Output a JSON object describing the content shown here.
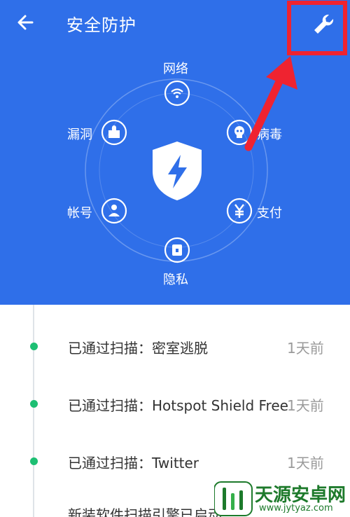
{
  "header": {
    "title": "安全防护",
    "back_icon": "arrow-left-icon",
    "settings_icon": "wrench-icon",
    "background_color": "#2f6fe9"
  },
  "annotation": {
    "box_color": "#ef2330",
    "arrow_color": "#ef2330"
  },
  "protection": {
    "center_icon": "lightning-shield-icon",
    "items": [
      {
        "label": "网络",
        "icon": "wifi-icon"
      },
      {
        "label": "病毒",
        "icon": "skull-icon"
      },
      {
        "label": "支付",
        "icon": "yen-icon"
      },
      {
        "label": "隐私",
        "icon": "lock-icon"
      },
      {
        "label": "帐号",
        "icon": "user-icon"
      },
      {
        "label": "漏洞",
        "icon": "puzzle-icon"
      }
    ]
  },
  "scan_log": {
    "items": [
      {
        "text": "已通过扫描：密室逃脱",
        "time": "1天前"
      },
      {
        "text": "已通过扫描：Hotspot Shield Free",
        "time": "1天前"
      },
      {
        "text": "已通过扫描：Twitter",
        "time": "1天前"
      }
    ],
    "partial_item": "新装软件扫描引擎已启动"
  },
  "watermark": {
    "title": "天源安卓网",
    "url": "www.jytyaz.com"
  }
}
